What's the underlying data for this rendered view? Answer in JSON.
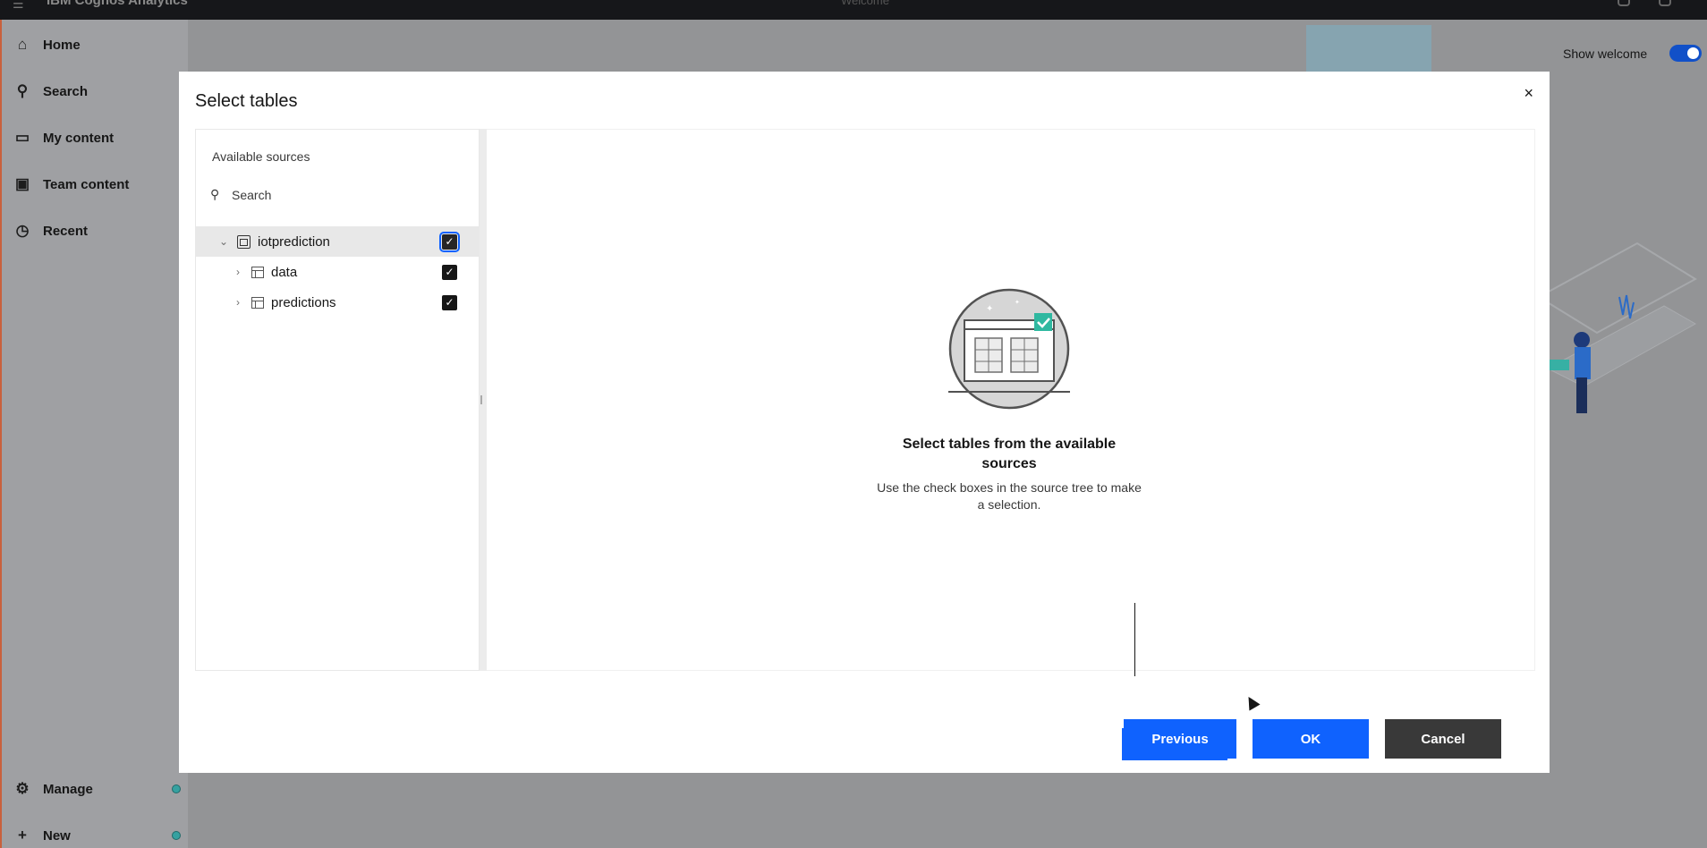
{
  "topbar": {
    "app_name": "IBM Cognos Analytics",
    "center_text": "Welcome"
  },
  "sidebar": {
    "items": [
      {
        "label": "Home",
        "icon": "home-icon"
      },
      {
        "label": "Search",
        "icon": "search-icon"
      },
      {
        "label": "My content",
        "icon": "folder-icon"
      },
      {
        "label": "Team content",
        "icon": "team-folder-icon"
      },
      {
        "label": "Recent",
        "icon": "clock-icon"
      }
    ],
    "bottom_items": [
      {
        "label": "Manage",
        "icon": "manage-icon"
      },
      {
        "label": "New",
        "icon": "plus-icon"
      }
    ]
  },
  "welcome": {
    "show_welcome_label": "Show welcome",
    "show_welcome_on": true
  },
  "modal": {
    "title": "Select tables",
    "close_label": "×",
    "sources": {
      "header": "Available sources",
      "search_placeholder": "Search",
      "tree": [
        {
          "label": "iotprediction",
          "checked": true,
          "expanded": true
        },
        {
          "label": "data",
          "checked": true,
          "expanded": false
        },
        {
          "label": "predictions",
          "checked": true,
          "expanded": false
        }
      ]
    },
    "empty_state": {
      "title": "Select tables from the available sources",
      "description": "Use the check boxes in the source tree to make a selection."
    },
    "buttons": {
      "previous": "Previous",
      "ok": "OK",
      "cancel": "Cancel"
    }
  },
  "colors": {
    "primary": "#0f62fe",
    "secondary": "#393939",
    "accent_teal": "#36a1a0"
  }
}
